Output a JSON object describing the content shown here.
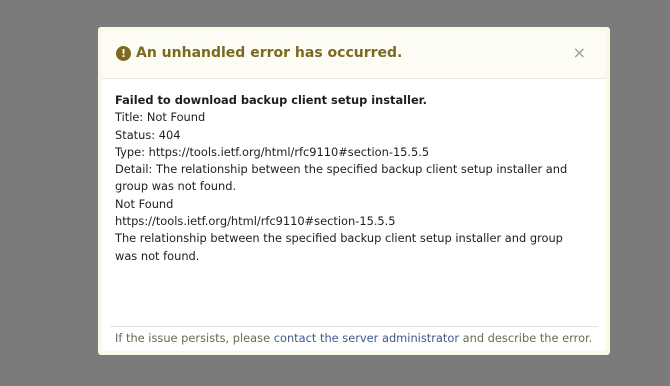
{
  "dialog": {
    "title": "An unhandled error has occurred.",
    "close_symbol": "×",
    "warning_icon_symbol": "!",
    "warning_icon": "exclamation-circle-icon",
    "title_color": "#7a6a20"
  },
  "error": {
    "heading": "Failed to download backup client setup installer.",
    "lines": [
      "Title: Not Found",
      "Status: 404",
      "Type: https://tools.ietf.org/html/rfc9110#section-15.5.5",
      "Detail: The relationship between the specified backup client setup installer and group was not found.",
      "Not Found",
      "https://tools.ietf.org/html/rfc9110#section-15.5.5",
      "The relationship between the specified backup client setup installer and group was not found."
    ]
  },
  "footer": {
    "prefix": "If the issue persists, please ",
    "link_text": "contact the server administrator",
    "suffix": " and describe the error."
  }
}
